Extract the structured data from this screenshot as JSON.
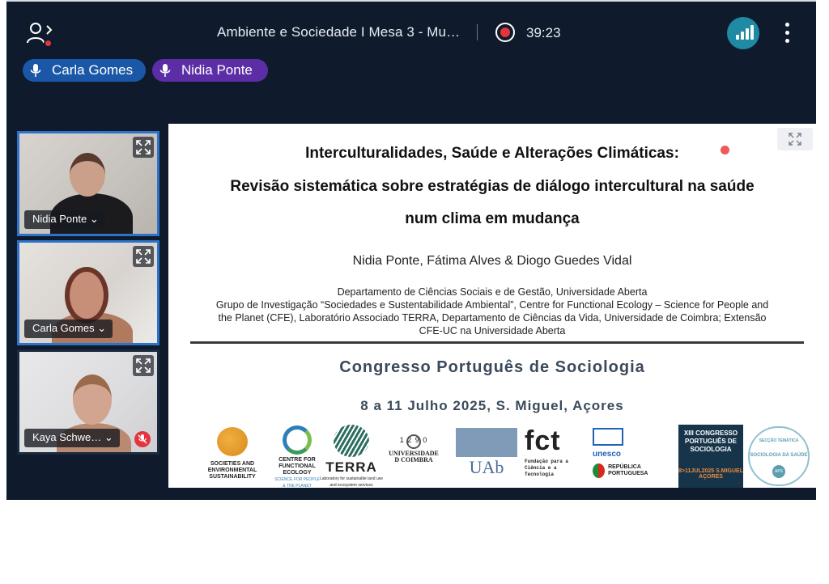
{
  "meeting": {
    "title": "Ambiente e Sociedade I Mesa 3 - Mu…",
    "recording_time": "39:23",
    "participants_icon": "people-icon",
    "signal_icon": "signal-bars-icon",
    "more_icon": "more-vertical-icon",
    "colors": {
      "background": "#0f1b2d",
      "accent_blue": "#1a58a7",
      "accent_purple": "#5b2ea6",
      "record_red": "#e5343b",
      "signal_teal": "#1e8aa4"
    }
  },
  "speaking_chips": [
    {
      "name": "Carla Gomes",
      "icon": "mic-icon"
    },
    {
      "name": "Nidia Ponte",
      "icon": "mic-icon"
    }
  ],
  "tiles": [
    {
      "name": "Nidia Ponte ⌄",
      "muted": false
    },
    {
      "name": "Carla Gomes ⌄",
      "muted": false
    },
    {
      "name": "Kaya Schwe… ⌄",
      "muted": true
    }
  ],
  "slide": {
    "title_lines": [
      "Interculturalidades, Saúde e Alterações Climáticas:",
      "Revisão sistemática sobre estratégias de diálogo intercultural na saúde",
      "num clima em mudança"
    ],
    "authors": "Nidia Ponte, Fátima Alves & Diogo Guedes Vidal",
    "affiliation_lines": [
      "Departamento de Ciências Sociais e de Gestão, Universidade Aberta",
      "Grupo de Investigação “Sociedades e Sustentabilidade Ambiental”, Centre for Functional Ecology – Science for People and",
      "the Planet (CFE), Laboratório Associado TERRA, Departamento de Ciências da Vida, Universidade de Coimbra; Extensão",
      "CFE-UC na Universidade Aberta"
    ],
    "congress": "Congresso Português de Sociologia",
    "dates": "8 a 11 Julho 2025, S. Miguel, Açores",
    "logos": {
      "sesust": "SOCIETIES AND ENVIRONMENTAL SUSTAINABILITY",
      "cfe": "CENTRE FOR FUNCTIONAL ECOLOGY",
      "cfe_sub": "SCIENCE FOR PEOPLE & THE PLANET",
      "terra": "TERRA",
      "terra_sub": "Laboratory for sustainable land use and ecosystem services",
      "coimbra_year": "1 2 9 0",
      "coimbra": "UNIVERSIDADE D COIMBRA",
      "uab": "UAb",
      "fct": "fct",
      "fct_sub": "Fundação para a Ciência e a Tecnologia",
      "unesco": "unesco",
      "republica": "REPÚBLICA PORTUGUESA",
      "congress_badge": "XIII CONGRESSO PORTUGUÊS DE SOCIOLOGIA",
      "congress_dates": "8>11JUL2025 S.MIGUEL AÇORES",
      "seccao": "SECÇÃO TEMÁTICA",
      "seccao_name": "SOCIOLOGIA DA SAÚDE",
      "aps": "APS"
    }
  }
}
